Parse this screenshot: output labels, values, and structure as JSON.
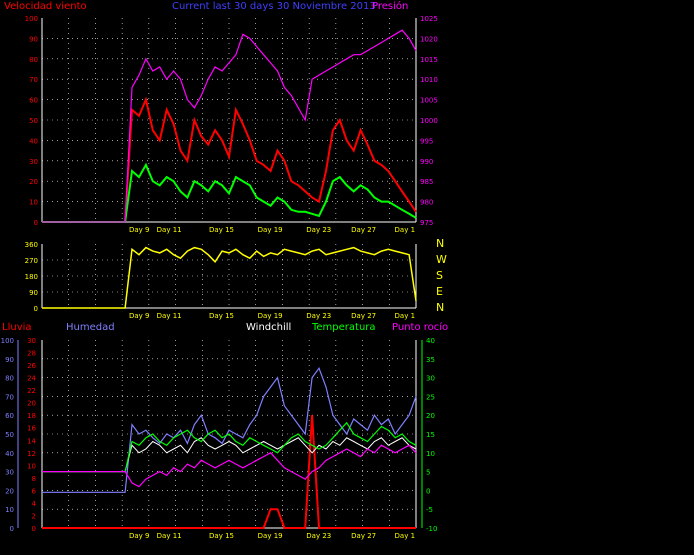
{
  "colors": {
    "wind": "#ff0000",
    "gust": "#ff0000",
    "avg": "#00ff00",
    "pressure": "#ff00ff",
    "direction": "#ffff00",
    "rain": "#ff0000",
    "humidity": "#7f7fff",
    "windchill": "#ffffff",
    "temperature": "#00ff00",
    "dewpoint": "#ff00ff",
    "axis": "#ffffff",
    "grid": "#ffffff"
  },
  "header": {
    "wind_label": "Velocidad viento",
    "period_label": "Current last 30 days 30 Noviembre 2013",
    "pressure_label": "Presión"
  },
  "legend2": {
    "rain": "Lluvia",
    "humidity": "Humedad",
    "windchill": "Windchill",
    "temperature": "Temperatura",
    "dewpoint": "Punto rocío"
  },
  "compass": [
    "N",
    "W",
    "S",
    "E",
    "N"
  ],
  "x_ticks": [
    "Day 9",
    "Day 11",
    "Day 15",
    "Day 19",
    "Day 23",
    "Day 27",
    "Day 1"
  ],
  "chart_data": [
    {
      "type": "line",
      "title": "Velocidad viento / Presión",
      "y_ticks_left": [
        "0",
        "10",
        "20",
        "30",
        "40",
        "50",
        "60",
        "70",
        "80",
        "90",
        "100"
      ],
      "y_ticks_right": [
        "975",
        "980",
        "985",
        "990",
        "995",
        "1000",
        "1005",
        "1010",
        "1015",
        "1020",
        "1025"
      ],
      "ylim_left": [
        0,
        100
      ],
      "ylim_right": [
        975,
        1025
      ],
      "series": [
        {
          "name": "Velocidad viento (racha)",
          "values": [
            0,
            0,
            0,
            0,
            0,
            0,
            0,
            0,
            0,
            0,
            0,
            0,
            0,
            55,
            52,
            60,
            45,
            40,
            55,
            48,
            35,
            30,
            50,
            42,
            38,
            45,
            40,
            32,
            55,
            48,
            40,
            30,
            28,
            25,
            35,
            30,
            20,
            18,
            15,
            12,
            10,
            25,
            45,
            50,
            40,
            35,
            45,
            38,
            30,
            28,
            25,
            20,
            15,
            10,
            5
          ]
        },
        {
          "name": "Velocidad viento (media)",
          "values": [
            0,
            0,
            0,
            0,
            0,
            0,
            0,
            0,
            0,
            0,
            0,
            0,
            0,
            25,
            22,
            28,
            20,
            18,
            22,
            20,
            15,
            12,
            20,
            18,
            15,
            20,
            18,
            14,
            22,
            20,
            18,
            12,
            10,
            8,
            12,
            10,
            6,
            5,
            5,
            4,
            3,
            10,
            20,
            22,
            18,
            15,
            18,
            16,
            12,
            10,
            10,
            8,
            6,
            4,
            2
          ]
        },
        {
          "name": "Presión",
          "values": [
            975,
            975,
            975,
            975,
            975,
            975,
            975,
            975,
            975,
            975,
            975,
            975,
            975,
            1008,
            1011,
            1015,
            1012,
            1013,
            1010,
            1012,
            1010,
            1005,
            1003,
            1006,
            1010,
            1013,
            1012,
            1014,
            1016,
            1021,
            1020,
            1018,
            1016,
            1014,
            1012,
            1008,
            1006,
            1003,
            1000,
            1010,
            1011,
            1012,
            1013,
            1014,
            1015,
            1016,
            1016,
            1017,
            1018,
            1019,
            1020,
            1021,
            1022,
            1020,
            1017
          ]
        }
      ]
    },
    {
      "type": "line",
      "title": "Dirección viento",
      "y_ticks": [
        "0",
        "90",
        "180",
        "270",
        "360"
      ],
      "ylim": [
        0,
        360
      ],
      "series": [
        {
          "name": "Dirección",
          "values": [
            0,
            0,
            0,
            0,
            0,
            0,
            0,
            0,
            0,
            0,
            0,
            0,
            0,
            330,
            300,
            340,
            320,
            310,
            330,
            300,
            280,
            320,
            340,
            330,
            300,
            260,
            320,
            310,
            330,
            300,
            280,
            320,
            290,
            310,
            300,
            330,
            320,
            310,
            300,
            320,
            330,
            300,
            310,
            320,
            330,
            340,
            320,
            310,
            300,
            320,
            330,
            320,
            310,
            300,
            40
          ]
        }
      ]
    },
    {
      "type": "line",
      "title": "Lluvia / Humedad / Temperatura",
      "y_ticks_hum": [
        "0",
        "10",
        "20",
        "30",
        "40",
        "50",
        "60",
        "70",
        "80",
        "90",
        "100"
      ],
      "y_ticks_rain": [
        "0",
        "2",
        "4",
        "6",
        "8",
        "10",
        "12",
        "14",
        "16",
        "18",
        "20",
        "22",
        "24",
        "26",
        "28",
        "30"
      ],
      "y_ticks_temp": [
        "-10",
        "-5",
        "0",
        "5",
        "10",
        "15",
        "20",
        "25",
        "30",
        "35",
        "40"
      ],
      "ylim_hum": [
        0,
        100
      ],
      "ylim_rain": [
        0,
        30
      ],
      "ylim_temp": [
        -10,
        40
      ],
      "series": [
        {
          "name": "Lluvia",
          "values": [
            0,
            0,
            0,
            0,
            0,
            0,
            0,
            0,
            0,
            0,
            0,
            0,
            0,
            0,
            0,
            0,
            0,
            0,
            0,
            0,
            0,
            0,
            0,
            0,
            0,
            0,
            0,
            0,
            0,
            0,
            0,
            0,
            0,
            3,
            3,
            0,
            0,
            0,
            0,
            18,
            0,
            0,
            0,
            0,
            0,
            0,
            0,
            0,
            0,
            0,
            0,
            0,
            0,
            0,
            0
          ]
        },
        {
          "name": "Humedad",
          "values": [
            19,
            19,
            19,
            19,
            19,
            19,
            19,
            19,
            19,
            19,
            19,
            19,
            19,
            55,
            50,
            52,
            48,
            45,
            50,
            48,
            52,
            45,
            55,
            60,
            50,
            48,
            45,
            52,
            50,
            48,
            55,
            60,
            70,
            75,
            80,
            65,
            60,
            55,
            50,
            80,
            85,
            75,
            60,
            55,
            50,
            58,
            55,
            52,
            60,
            55,
            58,
            50,
            55,
            60,
            70
          ]
        },
        {
          "name": "Windchill",
          "values": [
            5,
            5,
            5,
            5,
            5,
            5,
            5,
            5,
            5,
            5,
            5,
            5,
            5,
            12,
            10,
            11,
            13,
            12,
            10,
            11,
            12,
            10,
            13,
            14,
            12,
            11,
            12,
            13,
            12,
            10,
            11,
            12,
            13,
            12,
            11,
            12,
            13,
            14,
            12,
            10,
            12,
            11,
            13,
            12,
            14,
            13,
            12,
            11,
            13,
            14,
            12,
            13,
            14,
            12,
            11
          ]
        },
        {
          "name": "Temperatura",
          "values": [
            5,
            5,
            5,
            5,
            5,
            5,
            5,
            5,
            5,
            5,
            5,
            5,
            5,
            13,
            12,
            14,
            15,
            13,
            12,
            14,
            15,
            16,
            14,
            13,
            15,
            16,
            14,
            15,
            13,
            12,
            14,
            13,
            12,
            11,
            10,
            12,
            14,
            15,
            13,
            12,
            11,
            12,
            14,
            16,
            18,
            15,
            14,
            13,
            15,
            17,
            16,
            14,
            15,
            13,
            12
          ]
        },
        {
          "name": "Punto rocío",
          "values": [
            5,
            5,
            5,
            5,
            5,
            5,
            5,
            5,
            5,
            5,
            5,
            5,
            5,
            2,
            1,
            3,
            4,
            5,
            4,
            6,
            5,
            7,
            6,
            8,
            7,
            6,
            7,
            8,
            7,
            6,
            7,
            8,
            9,
            10,
            8,
            6,
            5,
            4,
            3,
            5,
            6,
            8,
            9,
            10,
            11,
            10,
            9,
            11,
            10,
            12,
            11,
            10,
            11,
            12,
            10
          ]
        }
      ]
    }
  ]
}
